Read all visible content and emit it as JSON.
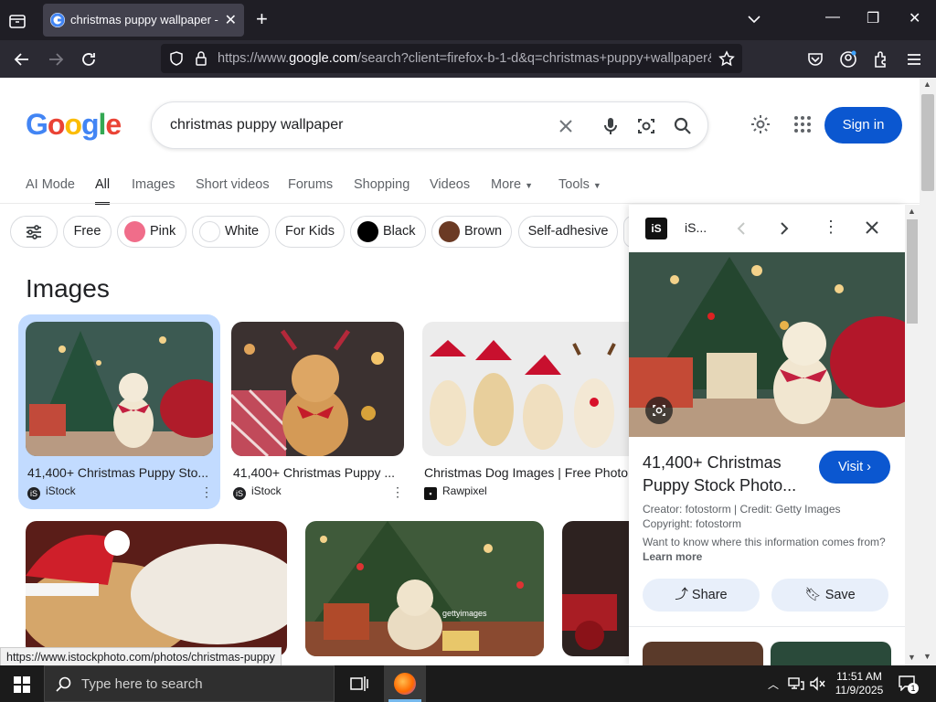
{
  "browser": {
    "tab_title": "christmas puppy wallpaper - Google Search",
    "url_prefix": "https://www.",
    "url_domain": "google.com",
    "url_rest": "/search?client=firefox-b-1-d&q=christmas+puppy+wallpaper&",
    "status_url": "https://www.istockphoto.com/photos/christmas-puppy"
  },
  "google": {
    "logo": "Google",
    "query": "christmas puppy wallpaper",
    "sign_in": "Sign in",
    "tabs": [
      "AI Mode",
      "All",
      "Images",
      "Short videos",
      "Forums",
      "Shopping",
      "Videos",
      "More",
      "Tools"
    ],
    "chips": [
      "Free",
      "Pink",
      "White",
      "For Kids",
      "Black",
      "Brown",
      "Self-adhesive"
    ],
    "chip_colors": {
      "Pink": "#f06d8a",
      "White": "#ffffff",
      "Black": "#000000",
      "Brown": "#6b3a24"
    },
    "images_heading": "Images",
    "results": [
      {
        "title": "41,400+ Christmas Puppy Sto...",
        "source": "iStock"
      },
      {
        "title": "41,400+ Christmas Puppy ...",
        "source": "iStock"
      },
      {
        "title": "Christmas Dog Images | Free Photo",
        "source": "Rawpixel"
      }
    ]
  },
  "panel": {
    "source_abbr": "iS...",
    "title": "41,400+ Christmas Puppy Stock Photo...",
    "visit": "Visit",
    "creator": "Creator: fotostorm | Credit: Getty Images",
    "copyright": "Copyright: fotostorm",
    "question": "Want to know where this information comes from?",
    "learn_more": "Learn more",
    "share": "Share",
    "save": "Save"
  },
  "taskbar": {
    "search_placeholder": "Type here to search",
    "time": "11:51 AM",
    "date": "11/9/2025",
    "notifications": "1"
  },
  "colors": {
    "accent": "#0b57d0",
    "selected_card": "#c2dbff"
  }
}
